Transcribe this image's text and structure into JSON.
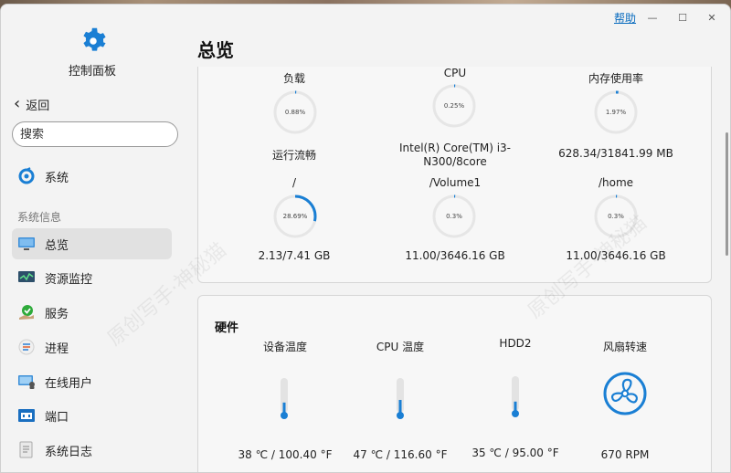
{
  "app": {
    "title": "控制面板"
  },
  "titlebar": {
    "help": "帮助",
    "minimize": "—",
    "maximize": "☐",
    "close": "✕"
  },
  "sidebar": {
    "back_label": "返回",
    "search_placeholder": "搜索",
    "system_label": "系统",
    "section_label": "系统信息",
    "items": [
      {
        "label": "总览",
        "icon": "monitor-icon",
        "active": true
      },
      {
        "label": "资源监控",
        "icon": "resource-monitor-icon"
      },
      {
        "label": "服务",
        "icon": "services-icon"
      },
      {
        "label": "进程",
        "icon": "process-icon"
      },
      {
        "label": "在线用户",
        "icon": "online-users-icon"
      },
      {
        "label": "端口",
        "icon": "port-icon"
      },
      {
        "label": "系统日志",
        "icon": "system-log-icon"
      }
    ]
  },
  "page": {
    "title": "总览"
  },
  "status": {
    "row1": [
      {
        "label": "负载",
        "ring": "0.88%",
        "percent": 0.88,
        "value": ""
      },
      {
        "label": "CPU",
        "ring": "0.25%",
        "percent": 0.25,
        "value": "Intel(R) Core(TM) i3-N300/8core"
      },
      {
        "label": "内存使用率",
        "ring": "1.97%",
        "percent": 1.97,
        "value": "628.34/31841.99 MB"
      }
    ],
    "row1_extra": {
      "label": "运行流畅"
    },
    "row2": [
      {
        "label": "/",
        "ring": "28.69%",
        "percent": 28.69,
        "value": "2.13/7.41 GB"
      },
      {
        "label": "/Volume1",
        "ring": "0.3%",
        "percent": 0.3,
        "value": "11.00/3646.16 GB"
      },
      {
        "label": "/home",
        "ring": "0.3%",
        "percent": 0.3,
        "value": "11.00/3646.16 GB"
      }
    ]
  },
  "hardware": {
    "title": "硬件",
    "items": [
      {
        "label": "设备温度",
        "value": "38 ℃ / 100.40 °F",
        "level": 0.38
      },
      {
        "label": "CPU 温度",
        "value": "47 ℃ / 116.60 °F",
        "level": 0.47
      },
      {
        "label": "HDD2",
        "value": "35 ℃ / 95.00 °F",
        "level": 0.35
      },
      {
        "label": "风扇转速",
        "value": "670 RPM"
      }
    ]
  },
  "colors": {
    "accent": "#1a7fd4",
    "ring_track": "#e6e6e6"
  },
  "watermark": "原创写手·神秘猫"
}
